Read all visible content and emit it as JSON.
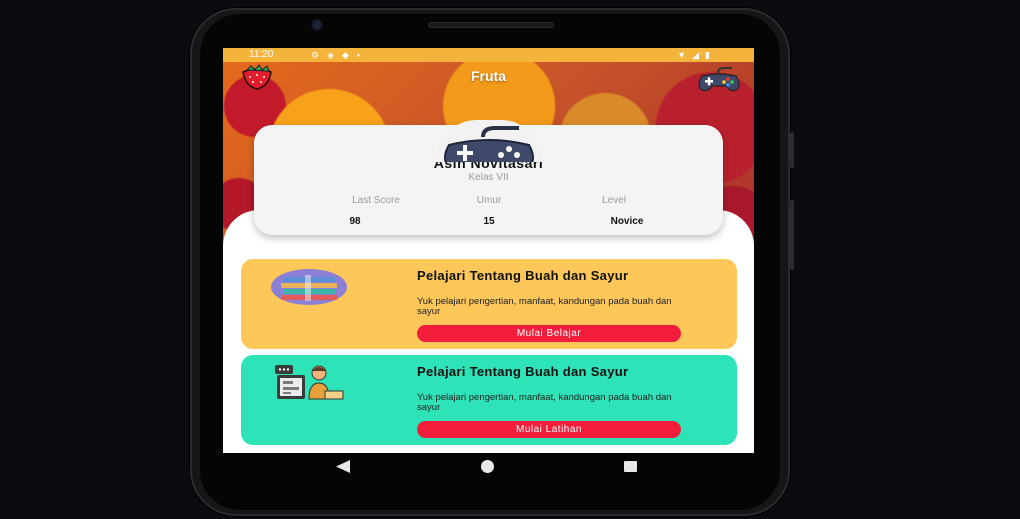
{
  "statusbar": {
    "time": "11:20"
  },
  "app": {
    "title": "Fruta"
  },
  "profile": {
    "name": "Asih Novitasari",
    "class": "Kelas VII",
    "stats": [
      {
        "label": "Last Score",
        "value": "98"
      },
      {
        "label": "Umur",
        "value": "15"
      },
      {
        "label": "Level",
        "value": "Novice"
      }
    ]
  },
  "cards": [
    {
      "title": "Pelajari Tentang Buah dan Sayur",
      "description": "Yuk pelajari pengertian, manfaat, kandungan pada buah dan sayur",
      "button": "Mulai Belajar",
      "color": "#fdc75a"
    },
    {
      "title": "Pelajari Tentang Buah dan Sayur",
      "description": "Yuk pelajari pengertian, manfaat, kandungan pada buah dan sayur",
      "button": "Mulai Latihan",
      "color": "#2ee3b7"
    }
  ],
  "colors": {
    "statusbar": "#f4b43c",
    "button": "#f21d3a"
  },
  "icons": {
    "top_left": "strawberry-icon",
    "top_right": "gamepad-icon",
    "avatar": "gamepad-avatar-icon",
    "card1": "books-icon",
    "card2": "teacher-icon"
  }
}
